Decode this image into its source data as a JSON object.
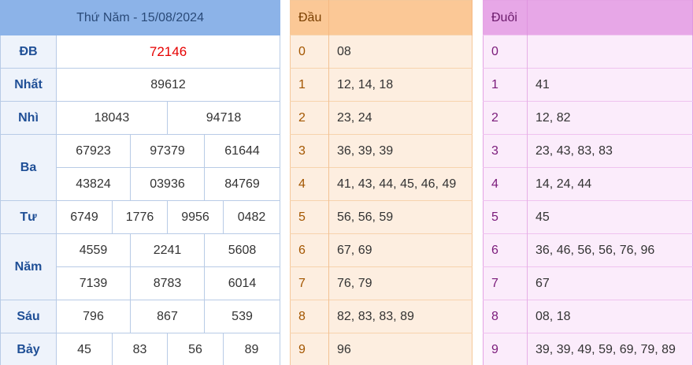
{
  "header": {
    "title": "Thứ Năm - 15/08/2024"
  },
  "prizes": {
    "db": {
      "label": "ĐB",
      "numbers": [
        "72146"
      ]
    },
    "nhat": {
      "label": "Nhất",
      "numbers": [
        "89612"
      ]
    },
    "nhi": {
      "label": "Nhì",
      "numbers": [
        "18043",
        "94718"
      ]
    },
    "ba": {
      "label": "Ba",
      "numbers": [
        "67923",
        "97379",
        "61644",
        "43824",
        "03936",
        "84769"
      ]
    },
    "tu": {
      "label": "Tư",
      "numbers": [
        "6749",
        "1776",
        "9956",
        "0482"
      ]
    },
    "nam": {
      "label": "Năm",
      "numbers": [
        "4559",
        "2241",
        "5608",
        "7139",
        "8783",
        "6014"
      ]
    },
    "sau": {
      "label": "Sáu",
      "numbers": [
        "796",
        "867",
        "539"
      ]
    },
    "bay": {
      "label": "Bảy",
      "numbers": [
        "45",
        "83",
        "56",
        "89"
      ]
    }
  },
  "dau": {
    "title": "Đầu",
    "rows": [
      {
        "key": "0",
        "nums": "08"
      },
      {
        "key": "1",
        "nums": "12, 14, 18"
      },
      {
        "key": "2",
        "nums": "23, 24"
      },
      {
        "key": "3",
        "nums": "36, 39, 39"
      },
      {
        "key": "4",
        "nums": "41, 43, 44, 45, 46, 49"
      },
      {
        "key": "5",
        "nums": "56, 56, 59"
      },
      {
        "key": "6",
        "nums": "67, 69"
      },
      {
        "key": "7",
        "nums": "76, 79"
      },
      {
        "key": "8",
        "nums": "82, 83, 83, 89"
      },
      {
        "key": "9",
        "nums": "96"
      }
    ]
  },
  "duoi": {
    "title": "Đuôi",
    "rows": [
      {
        "key": "0",
        "nums": ""
      },
      {
        "key": "1",
        "nums": "41"
      },
      {
        "key": "2",
        "nums": "12, 82"
      },
      {
        "key": "3",
        "nums": "23, 43, 83, 83"
      },
      {
        "key": "4",
        "nums": "14, 24, 44"
      },
      {
        "key": "5",
        "nums": "45"
      },
      {
        "key": "6",
        "nums": "36, 46, 56, 56, 76, 96"
      },
      {
        "key": "7",
        "nums": "67"
      },
      {
        "key": "8",
        "nums": "08, 18"
      },
      {
        "key": "9",
        "nums": "39, 39, 49, 59, 69, 79, 89"
      }
    ]
  },
  "colors": {
    "special_prize": "#e60000",
    "prize_header": "#8cb3e8",
    "dau_header": "#fbc896",
    "duoi_header": "#e7a7e7"
  }
}
